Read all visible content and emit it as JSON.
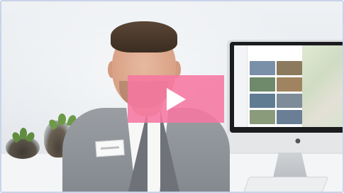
{
  "video": {
    "play_button": {
      "icon": "play-icon",
      "color": "#f676a1"
    }
  },
  "colors": {
    "accent": "#f676a1",
    "frame_border": "#c9d4ea"
  }
}
